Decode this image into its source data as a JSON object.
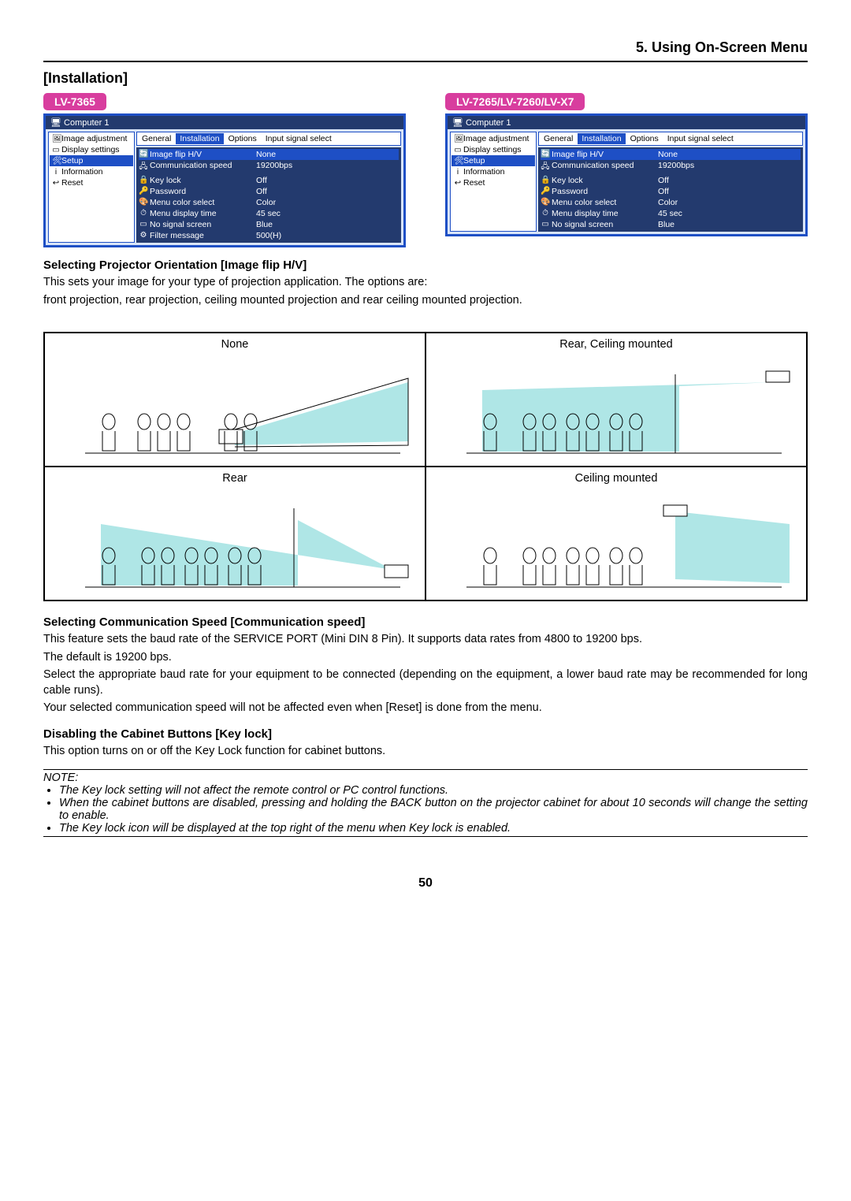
{
  "header": {
    "title": "5. Using On-Screen Menu"
  },
  "section": {
    "title": "[Installation]"
  },
  "models": {
    "left": "LV-7365",
    "right": "LV-7265/LV-7260/LV-X7"
  },
  "menu": {
    "title": "Computer 1",
    "sidebar": [
      {
        "label": "Image adjustment",
        "icon": "🖼",
        "iconName": "image-icon"
      },
      {
        "label": "Display settings",
        "icon": "▭",
        "iconName": "display-icon"
      },
      {
        "label": "Setup",
        "icon": "🛠",
        "iconName": "setup-icon",
        "selected": true
      },
      {
        "label": "Information",
        "icon": "i",
        "iconName": "info-icon"
      },
      {
        "label": "Reset",
        "icon": "↩",
        "iconName": "reset-icon"
      }
    ],
    "tabs": [
      "General",
      "Installation",
      "Options",
      "Input signal select"
    ],
    "selected_tab": 1,
    "settings_left": [
      {
        "label": "Image flip H/V",
        "value": "None",
        "icon": "🔄",
        "iconName": "flip-icon",
        "highlight": true
      },
      {
        "label": "Communication speed",
        "value": "19200bps",
        "icon": "🖧",
        "iconName": "comm-icon"
      },
      {
        "label": "Key lock",
        "value": "Off",
        "icon": "🔒",
        "iconName": "lock-icon"
      },
      {
        "label": "Password",
        "value": "Off",
        "icon": "🔑",
        "iconName": "password-icon"
      },
      {
        "label": "Menu color select",
        "value": "Color",
        "icon": "🎨",
        "iconName": "color-icon"
      },
      {
        "label": "Menu display time",
        "value": "45 sec",
        "icon": "⏱",
        "iconName": "time-icon"
      },
      {
        "label": "No signal screen",
        "value": "Blue",
        "icon": "▭",
        "iconName": "screen-icon"
      },
      {
        "label": "Filter message",
        "value": "500(H)",
        "icon": "⚙",
        "iconName": "filter-icon"
      }
    ],
    "settings_right": [
      {
        "label": "Image flip H/V",
        "value": "None",
        "icon": "🔄",
        "iconName": "flip-icon",
        "highlight": true
      },
      {
        "label": "Communication speed",
        "value": "19200bps",
        "icon": "🖧",
        "iconName": "comm-icon"
      },
      {
        "label": "Key lock",
        "value": "Off",
        "icon": "🔒",
        "iconName": "lock-icon"
      },
      {
        "label": "Password",
        "value": "Off",
        "icon": "🔑",
        "iconName": "password-icon"
      },
      {
        "label": "Menu color select",
        "value": "Color",
        "icon": "🎨",
        "iconName": "color-icon"
      },
      {
        "label": "Menu display time",
        "value": "45 sec",
        "icon": "⏱",
        "iconName": "time-icon"
      },
      {
        "label": "No signal screen",
        "value": "Blue",
        "icon": "▭",
        "iconName": "screen-icon"
      }
    ]
  },
  "text": {
    "sub1": "Selecting Projector Orientation [Image flip H/V]",
    "p1": "This sets your image for your type of projection application. The options are:",
    "p2": "front projection, rear projection, ceiling mounted projection and rear ceiling mounted projection.",
    "orient": [
      "None",
      "Rear, Ceiling mounted",
      "Rear",
      "Ceiling mounted"
    ],
    "sub2": "Selecting Communication Speed [Communication speed]",
    "p3": "This feature sets the baud rate of the SERVICE PORT (Mini DIN 8 Pin). It supports data rates from 4800 to 19200 bps.",
    "p4": "The default is 19200 bps.",
    "p5": "Select the appropriate baud rate for your equipment to be connected (depending on the equipment, a lower baud rate may be recommended for long cable runs).",
    "p6": "Your selected communication speed will not be affected even when [Reset] is done from the menu.",
    "sub3": "Disabling the Cabinet Buttons [Key lock]",
    "p7": "This option turns on or off the Key Lock function for cabinet buttons.",
    "note_title": "NOTE:",
    "notes": [
      "The Key lock setting will not affect the remote control or PC control functions.",
      "When the cabinet buttons are disabled, pressing and holding the BACK button on the projector cabinet for about 10 seconds will change the setting to enable.",
      "The Key lock icon will be displayed at the top right of the menu when Key lock is enabled."
    ]
  },
  "page_number": "50"
}
